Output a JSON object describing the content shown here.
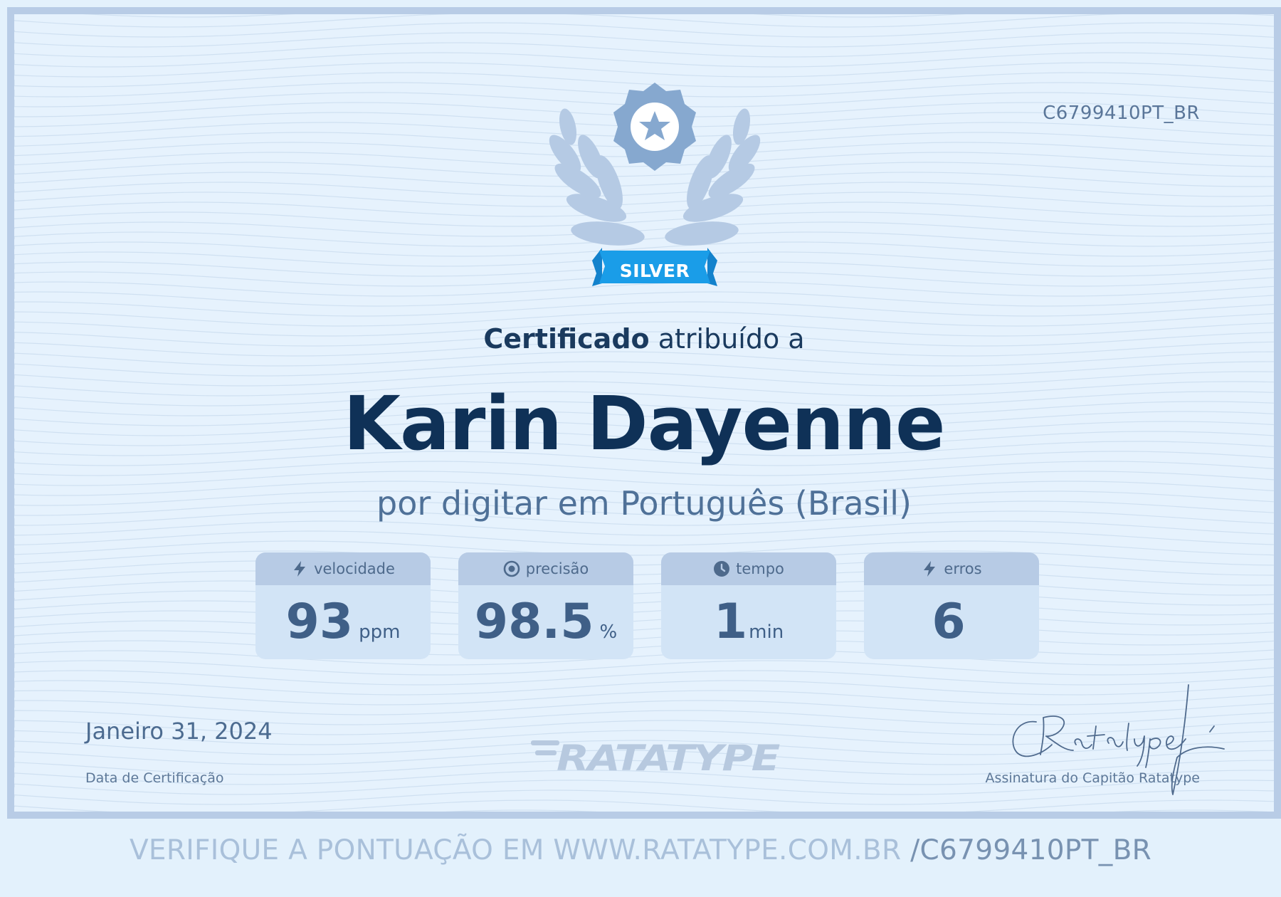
{
  "certificate": {
    "code": "C6799410PT_BR",
    "badge": {
      "level": "SILVER",
      "icon": "laurel-star-icon",
      "ribbon_color": "#1a9de8"
    },
    "awarded_prefix": "Certificado",
    "awarded_suffix": "atribuído a",
    "recipient_name": "Karin Dayenne",
    "subtitle": "por digitar em Português (Brasil)",
    "stats": [
      {
        "label": "velocidade",
        "icon": "lightning-icon",
        "value": "93",
        "unit": "ppm"
      },
      {
        "label": "precisão",
        "icon": "target-icon",
        "value": "98.5",
        "unit": "%"
      },
      {
        "label": "tempo",
        "icon": "clock-icon",
        "value": "1",
        "unit": "min"
      },
      {
        "label": "erros",
        "icon": "lightning-icon",
        "value": "6",
        "unit": ""
      }
    ],
    "date": "Janeiro 31, 2024",
    "date_label": "Data de Certificação",
    "brand_logo": "RATATYPE",
    "signature_label": "Assinatura do Capitão Ratatype"
  },
  "footer": {
    "verify_text": "VERIFIQUE A PONTUAÇÃO EM WWW.RATATYPE.COM.BR",
    "verify_code": "/C6799410PT_BR"
  }
}
